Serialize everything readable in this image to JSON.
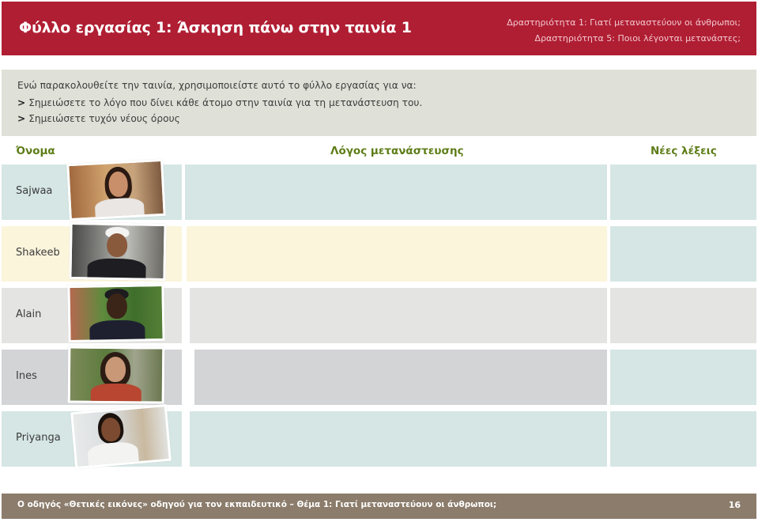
{
  "header": {
    "title": "Φύλλο εργασίας 1: Άσκηση πάνω στην ταινία 1",
    "activity_1": "Δραστηριότητα 1: Γιατί μεταναστεύουν οι άνθρωποι;",
    "activity_5": "Δραστηριότητα 5: Ποιοι λέγονται μετανάστες;"
  },
  "instructions": {
    "intro": "Ενώ παρακολουθείτε την ταινία, χρησιμοποιείστε αυτό το φύλλο εργασίας για να:",
    "bullet_marker": ">",
    "bullet_1": "Σημειώσετε το λόγο που δίνει κάθε άτομο στην ταινία για τη μετανάστευση του.",
    "bullet_2": "Σημειώσετε τυχόν νέους όρους"
  },
  "table": {
    "headers": {
      "name": "Όνομα",
      "reason": "Λόγος μετανάστευσης",
      "new_words": "Νέες λέξεις"
    },
    "rows": [
      {
        "name": "Sajwaa",
        "color": "#d5e6e4"
      },
      {
        "name": "Shakeeb",
        "color": "#fbf5dc"
      },
      {
        "name": "Alain",
        "color": "#e4e5e2"
      },
      {
        "name": "Ines",
        "color": "#d3d4d6"
      },
      {
        "name": "Priyanga",
        "color": "#d5e6e4"
      }
    ]
  },
  "footer": {
    "text": "Ο οδηγός «Θετικές εικόνες» οδηγού για τον εκπαιδευτικό – Θέμα 1: Γιατί μεταναστεύουν οι άνθρωποι;",
    "page": "16"
  }
}
